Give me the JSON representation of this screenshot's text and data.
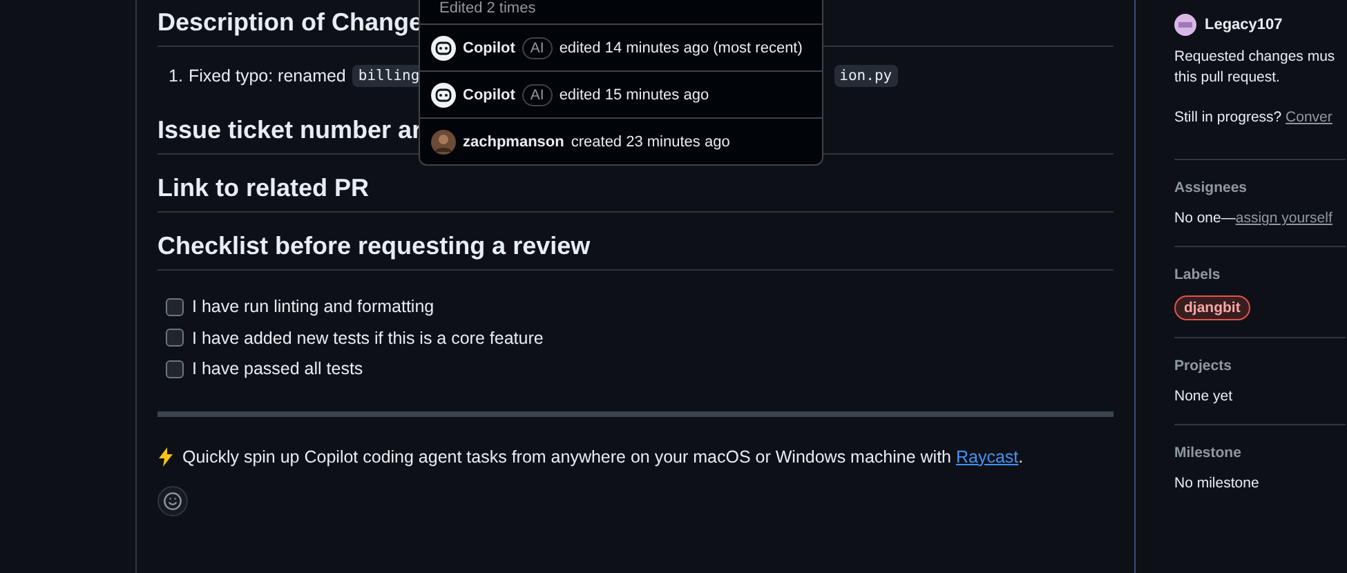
{
  "description": {
    "headings": [
      "Description of Change",
      "Issue ticket number ar",
      "Link to related PR",
      "Checklist before requesting a review"
    ],
    "change_item": {
      "number": "1.",
      "text": "Fixed typo: renamed",
      "code_before": "billing",
      "code_after": "ion.py"
    },
    "checklist": [
      {
        "label": "I have run linting and formatting",
        "checked": false
      },
      {
        "label": "I have added new tests if this is a core feature",
        "checked": false
      },
      {
        "label": "I have passed all tests",
        "checked": false
      }
    ],
    "footer": {
      "text_before": "Quickly spin up Copilot coding agent tasks from anywhere on your macOS or Windows machine with ",
      "link": "Raycast",
      "text_after": "."
    }
  },
  "edit_history": {
    "header": "Edited 2 times",
    "entries": [
      {
        "kind": "bot",
        "author": "Copilot",
        "badge": "AI",
        "action": "edited 14 minutes ago (most recent)"
      },
      {
        "kind": "bot",
        "author": "Copilot",
        "badge": "AI",
        "action": "edited 15 minutes ago"
      },
      {
        "kind": "user",
        "author": "zachpmanson",
        "action": "created 23 minutes ago"
      }
    ]
  },
  "sidebar": {
    "reviewer": "Legacy107",
    "review_note": [
      "Requested changes mus",
      "this pull request."
    ],
    "progress_question": "Still in progress?",
    "progress_link": "Conver",
    "sections": [
      {
        "title": "Assignees",
        "kind": "assign",
        "value": "No one—",
        "link": "assign yourself"
      },
      {
        "title": "Labels",
        "kind": "labels",
        "labels": [
          {
            "name": "djangbit",
            "color": "#e5534b"
          }
        ]
      },
      {
        "title": "Projects",
        "kind": "text",
        "value": "None yet"
      },
      {
        "title": "Milestone",
        "kind": "text",
        "value": "No milestone"
      }
    ]
  }
}
